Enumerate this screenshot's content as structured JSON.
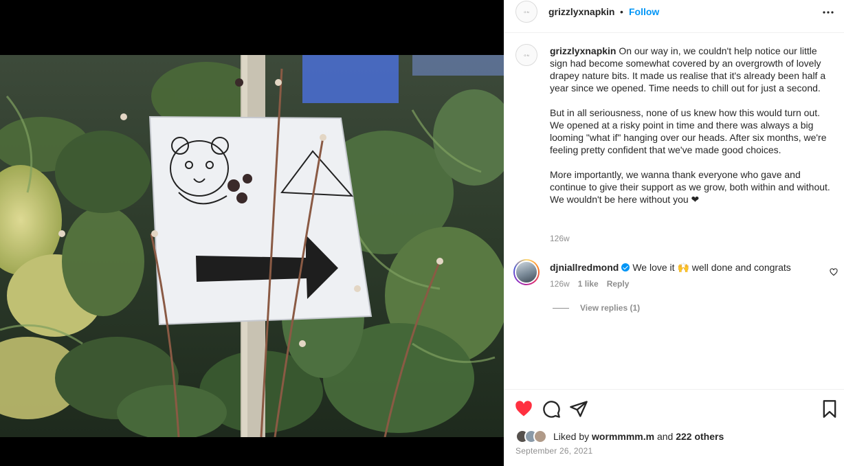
{
  "post": {
    "username": "grizzlyxnapkin",
    "separator": "•",
    "follow_label": "Follow",
    "more_icon": "more-horizontal-icon",
    "avatar_text": "G·N"
  },
  "caption": {
    "username": "grizzlyxnapkin",
    "paragraph1": "On our way in, we couldn't help notice our little sign had become somewhat covered by an overgrowth of lovely drapey nature bits. It made us realise that it's already been half a year since we opened. Time needs to chill out for just a second.",
    "paragraph2": "But in all seriousness, none of us knew how this would turn out. We opened at a risky point in time and there was always a big looming \"what if\" hanging over our heads. After six months, we're feeling pretty confident that we've made good choices.",
    "paragraph3": "More importantly, we wanna thank everyone who gave and continue to give their support as we grow, both within and without. We wouldn't be here without you ❤",
    "time": "126w"
  },
  "comment": {
    "username": "djniallredmond",
    "text": "We love it 🙌 well done and congrats",
    "time": "126w",
    "likes": "1 like",
    "reply_label": "Reply",
    "view_replies": "View replies (1)"
  },
  "footer": {
    "liked_by_prefix": "Liked by",
    "liked_by_user": "wormmmm.m",
    "liked_by_and": "and",
    "liked_by_others": "222 others",
    "date": "September 26, 2021"
  },
  "colors": {
    "link_blue": "#0095f6",
    "like_red": "#ff3040",
    "secondary_text": "#8e8e8e"
  }
}
